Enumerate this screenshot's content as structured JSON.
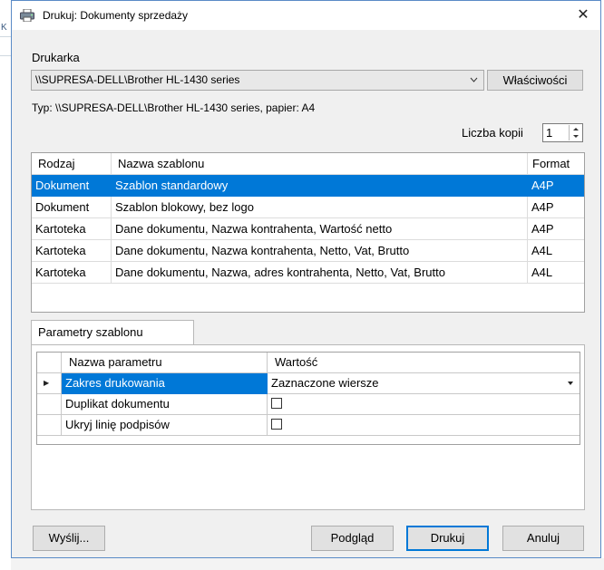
{
  "window": {
    "title": "Drukuj: Dokumenty sprzedaży",
    "close_glyph": "✕"
  },
  "printer": {
    "label": "Drukarka",
    "selected": "\\\\SUPRESA-DELL\\Brother HL-1430 series",
    "properties_label": "Właściwości",
    "type_info": "Typ: \\\\SUPRESA-DELL\\Brother HL-1430 series, papier: A4"
  },
  "copies": {
    "label": "Liczba kopii",
    "value": "1"
  },
  "templates": {
    "headers": [
      "Rodzaj",
      "Nazwa szablonu",
      "Format"
    ],
    "rows": [
      [
        "Dokument",
        "Szablon standardowy",
        "A4P"
      ],
      [
        "Dokument",
        "Szablon blokowy, bez logo",
        "A4P"
      ],
      [
        "Kartoteka",
        "Dane dokumentu, Nazwa kontrahenta, Wartość netto",
        "A4P"
      ],
      [
        "Kartoteka",
        "Dane dokumentu, Nazwa kontrahenta, Netto, Vat, Brutto",
        "A4L"
      ],
      [
        "Kartoteka",
        "Dane dokumentu, Nazwa, adres kontrahenta, Netto, Vat, Brutto",
        "A4L"
      ]
    ],
    "selected_index": 0
  },
  "params": {
    "tab_label": "Parametry szablonu",
    "headers": [
      "Nazwa parametru",
      "Wartość"
    ],
    "rows": [
      {
        "name": "Zakres drukowania",
        "value": "Zaznaczone wiersze",
        "kind": "combo"
      },
      {
        "name": "Duplikat dokumentu",
        "value": "",
        "kind": "checkbox",
        "checked": false
      },
      {
        "name": "Ukryj linię podpisów",
        "value": "",
        "kind": "checkbox",
        "checked": false
      }
    ],
    "current_marker": "▶"
  },
  "buttons": {
    "send": "Wyślij...",
    "preview": "Podgląd",
    "print": "Drukuj",
    "cancel": "Anuluj"
  },
  "colors": {
    "selection": "#0078d7",
    "dialog_bg": "#f0f0f0",
    "window_border": "#5a8bc7"
  },
  "icons": {
    "title": "printer-icon",
    "dropdown": "chevron-down-icon",
    "spinner": "spin-updown-icon",
    "row_marker": "row-pointer-icon"
  }
}
